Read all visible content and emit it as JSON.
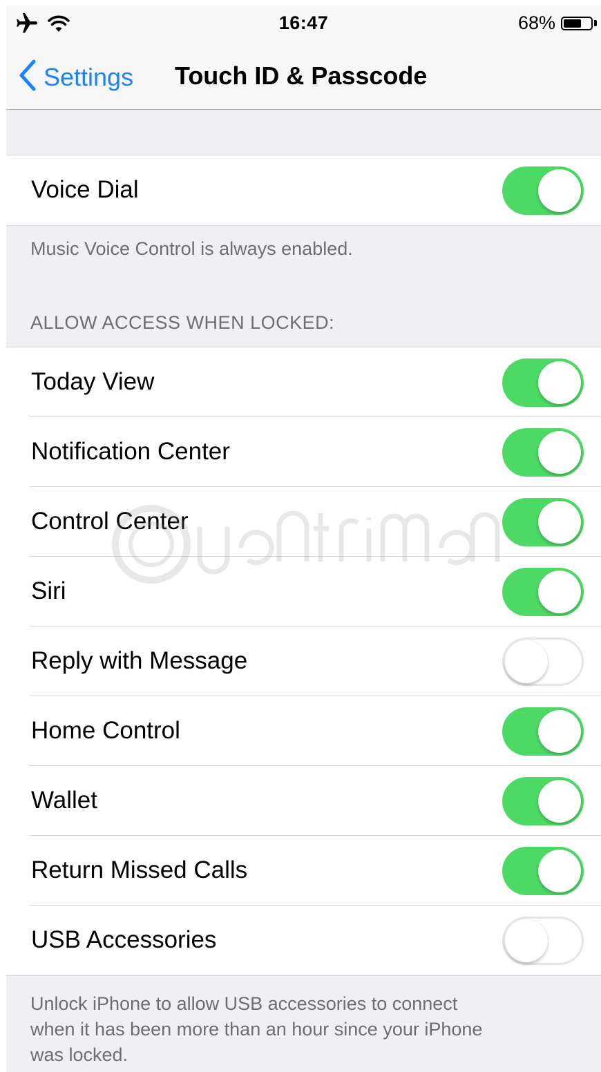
{
  "status_bar": {
    "time": "16:47",
    "battery_percent_text": "68%",
    "battery_level": 0.68,
    "icons": [
      "airplane-icon",
      "wifi-icon",
      "battery-icon"
    ]
  },
  "nav": {
    "back_label": "Settings",
    "title": "Touch ID & Passcode"
  },
  "voice_dial": {
    "label": "Voice Dial",
    "on": true,
    "footer": "Music Voice Control is always enabled."
  },
  "locked_access": {
    "header": "ALLOW ACCESS WHEN LOCKED:",
    "items": [
      {
        "label": "Today View",
        "on": true
      },
      {
        "label": "Notification Center",
        "on": true
      },
      {
        "label": "Control Center",
        "on": true
      },
      {
        "label": "Siri",
        "on": true
      },
      {
        "label": "Reply with Message",
        "on": false
      },
      {
        "label": "Home Control",
        "on": true
      },
      {
        "label": "Wallet",
        "on": true
      },
      {
        "label": "Return Missed Calls",
        "on": true
      },
      {
        "label": "USB Accessories",
        "on": false
      }
    ],
    "footer_lines": [
      "Unlock iPhone to allow USB accessories to connect",
      "when it has been more than an hour since your iPhone",
      "was locked."
    ]
  },
  "colors": {
    "accent": "#1a82fb",
    "toggle_on": "#4cd964",
    "grouped_background": "#efeff4",
    "secondary_text": "#6d6d72"
  }
}
